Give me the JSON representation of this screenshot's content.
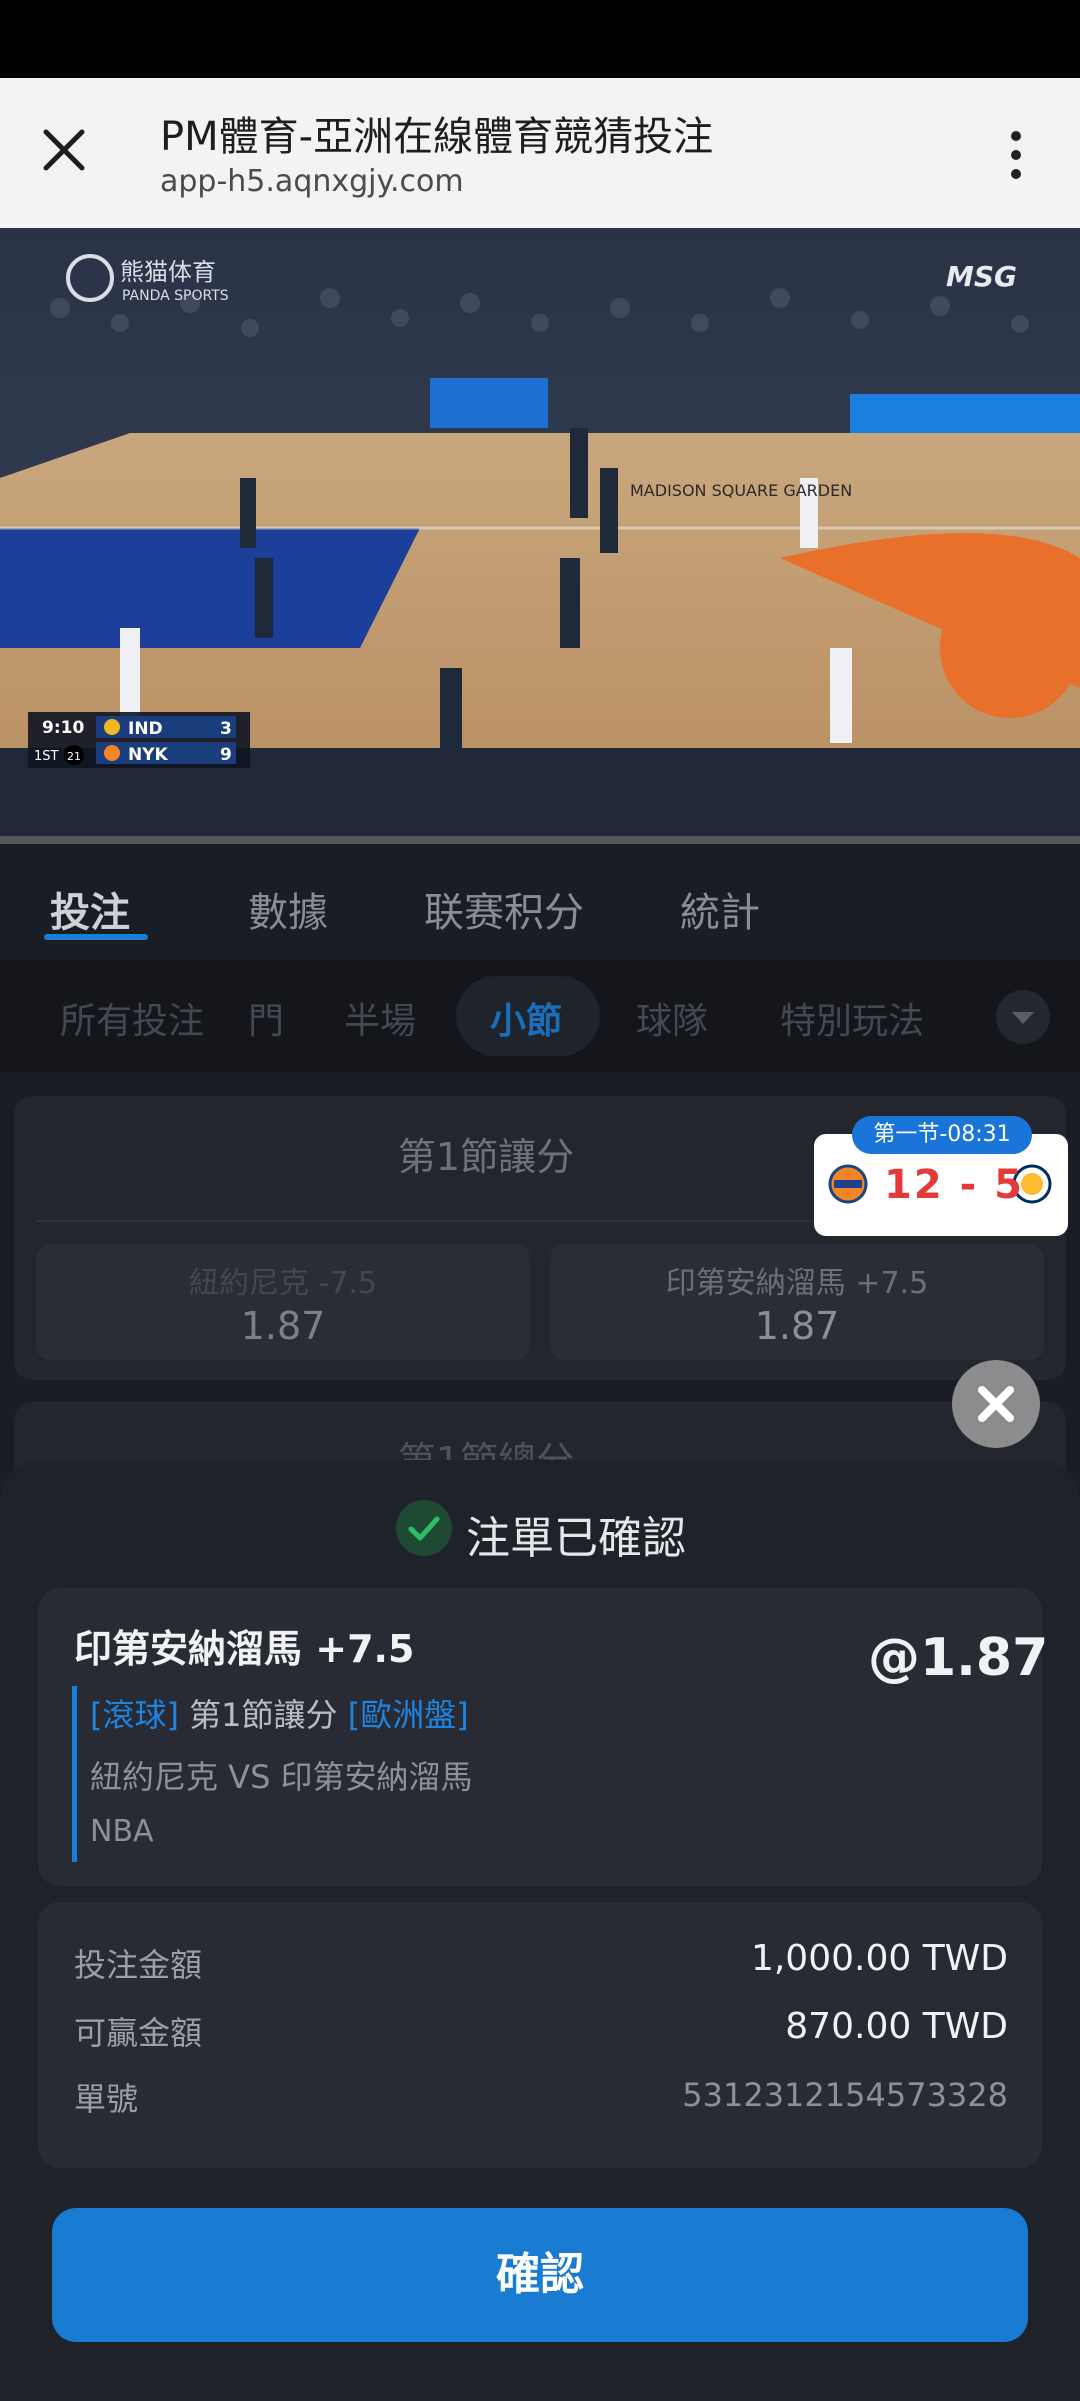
{
  "browser": {
    "title": "PM體育-亞洲在線體育競猜投注",
    "url": "app-h5.aqnxgjy.com"
  },
  "video": {
    "watermark_cn": "熊猫体育",
    "watermark_en": "PANDA SPORTS",
    "network_logo": "MSG",
    "arena_text": "MADISON SQUARE GARDEN",
    "scorebug": {
      "clock": "9:10",
      "period": "1ST",
      "shot_clock": "21",
      "team1": "IND",
      "team1_score": "3",
      "team2": "NYK",
      "team2_score": "9"
    }
  },
  "main_tabs": [
    {
      "label": "投注",
      "active": true
    },
    {
      "label": "數據",
      "active": false
    },
    {
      "label": "联赛积分",
      "active": false
    },
    {
      "label": "統計",
      "active": false
    }
  ],
  "sub_tabs": [
    {
      "label": "所有投注",
      "active": false
    },
    {
      "label": "門",
      "active": false
    },
    {
      "label": "半場",
      "active": false
    },
    {
      "label": "小節",
      "active": true
    },
    {
      "label": "球隊",
      "active": false
    },
    {
      "label": "特別玩法",
      "active": false
    }
  ],
  "market1": {
    "title": "第1節讓分",
    "options": [
      {
        "label": "紐約尼克 -7.5",
        "odds": "1.87"
      },
      {
        "label": "印第安納溜馬 +7.5",
        "odds": "1.87"
      }
    ]
  },
  "market2": {
    "title": "第1節總分"
  },
  "live_score": {
    "badge": "第一节-08:31",
    "score": "12 - 5"
  },
  "sheet": {
    "title": "注單已確認",
    "bet": {
      "selection": "印第安納溜馬 +7.5",
      "odds": "@1.87",
      "tag_live": "[滾球]",
      "market": "第1節讓分",
      "tag_odds_type": "[歐洲盤]",
      "match": "紐約尼克 VS 印第安納溜馬",
      "league": "NBA"
    },
    "info": {
      "stake_label": "投注金額",
      "stake_value": "1,000.00 TWD",
      "win_label": "可贏金額",
      "win_value": "870.00 TWD",
      "ticket_label": "單號",
      "ticket_value": "5312312154573328"
    },
    "confirm_label": "確認"
  },
  "colors": {
    "accent": "#1a7bd2",
    "sheet_bg": "#1f2229",
    "score_red": "#e53a3a"
  }
}
